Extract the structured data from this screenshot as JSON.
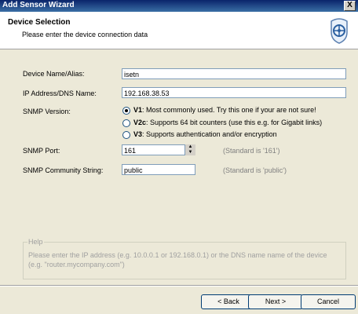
{
  "window": {
    "title": "Add Sensor Wizard",
    "close_label": "X"
  },
  "header": {
    "title": "Device Selection",
    "subtitle": "Please enter the device connection data",
    "icon": "sensor-wizard-icon"
  },
  "form": {
    "device_name_label": "Device Name/Alias:",
    "device_name_value": "isetn",
    "ip_label": "IP Address/DNS Name:",
    "ip_value": "192.168.38.53",
    "snmp_version_label": "SNMP Version:",
    "snmp_options": [
      {
        "key": "V1",
        "text": ": Most commonly used. Try this one if your are not sure!",
        "selected": true
      },
      {
        "key": "V2c",
        "text": ": Supports 64 bit counters (use this e.g. for Gigabit links)",
        "selected": false
      },
      {
        "key": "V3",
        "text": ": Supports authentication and/or encryption",
        "selected": false
      }
    ],
    "snmp_port_label": "SNMP Port:",
    "snmp_port_value": "161",
    "snmp_port_hint": "(Standard is '161')",
    "community_label": "SNMP Community String:",
    "community_value": "public",
    "community_hint": "(Standard is 'public')"
  },
  "help": {
    "label": "Help",
    "text": "Please enter the IP address (e.g. 10.0.0.1 or 192.168.0.1) or the DNS name name of the device (e.g. \"router.mycompany.com\")"
  },
  "buttons": {
    "back": "< Back",
    "next": "Next >",
    "cancel": "Cancel"
  }
}
